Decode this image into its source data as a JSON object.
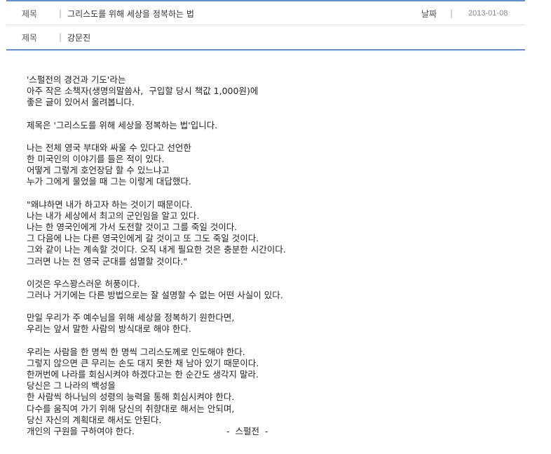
{
  "header": {
    "title_label": "제목",
    "title_value": "그리스도를 위해 세상을 정복하는 법",
    "date_label": "날짜",
    "date_value": "2013-01-08",
    "author_label": "제목",
    "author_value": "강문진",
    "separator": "|"
  },
  "body": {
    "paragraphs": [
      [
        "'스펄전의 경건과 기도'라는",
        "아주 작은 소책자(생명의말씀사,  구입할 당시 책값 1,000원)에",
        "좋은 글이 있어서 올려봅니다."
      ],
      [
        "제목은 '그리스도를 위해 세상을 정복하는 법'입니다."
      ],
      [
        "나는 전체 영국 부대와 싸울 수 있다고 선언한",
        "한 미국인의 이야기를 들은 적이 있다.",
        "어떻게 그렇게 호언장담 할 수 있느냐고",
        "누가 그에게 물었을 때 그는 이렇게 대답했다."
      ],
      [
        "\"왜냐하면 내가 하고자 하는 것이기 때문이다.",
        "나는 내가 세상에서 최고의 군인임을 알고 있다.",
        "나는 한 영국인에게 가서 도전할 것이고 그를 죽일 것이다.",
        "그 다음에 나는 다른 영국인에게 갈 것이고 또 그도 죽일 것이다.",
        "그와 같이 나는 계속할 것이다. 오직 내게 필요한 것은 충분한 시간이다.",
        "그러면 나는 전 영국 군대를 섬멸할 것이다.\""
      ],
      [
        "이것은 우스꽝스러운 허풍이다.",
        "그러나 거기에는 다른 방법으로는 잘 설명할 수 없는 어떤 사실이 있다."
      ],
      [
        "만일 우리가 주 예수님을 위해 세상을 정복하기 원한다면,",
        "우리는 앞서 말한 사람의 방식대로 해야 한다."
      ],
      [
        "우리는 사람을 한 명씩 한 명씩 그리스도께로 인도해야 한다.",
        "그렇지 않으면 큰 무리는 손도 대지 못한 채 남아 있기 때문이다.",
        "한꺼번에 나라를 회심시켜야 하겠다고는 한 순간도 생각지 말라.",
        "당신은 그 나라의 백성을",
        "한 사람씩 하나님의 성령의 능력을 통해 회심시켜야 한다.",
        "다수를 움직여 가기 위해 당신의 취향대로 해서는 안되며,",
        "당신 자신의 계획대로 해서도 안된다.",
        "개인의 구원을 구하여야 한다.                                 -  스펄전  -"
      ]
    ]
  }
}
